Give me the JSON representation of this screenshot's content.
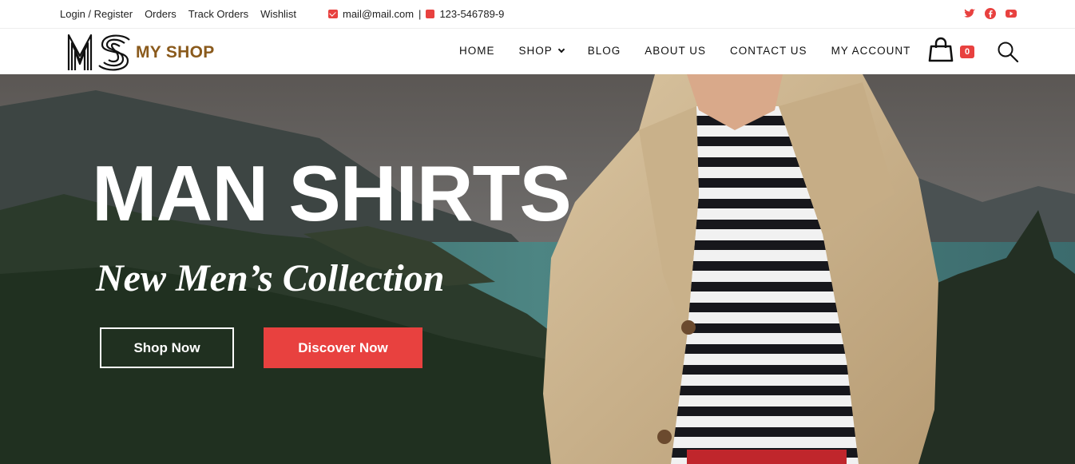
{
  "topbar": {
    "links": [
      "Login / Register",
      "Orders",
      "Track Orders",
      "Wishlist"
    ],
    "email": "mail@mail.com",
    "separator": "|",
    "phone": "123-546789-9",
    "social_icons": [
      "twitter-icon",
      "facebook-icon",
      "youtube-icon"
    ],
    "accent": "#e8413f"
  },
  "header": {
    "logo_mark": "MS",
    "logo_text": "MY SHOP",
    "nav": [
      "HOME",
      "SHOP",
      "BLOG",
      "ABOUT US",
      "CONTACT US",
      "MY ACCOUNT"
    ],
    "cart_count": "0"
  },
  "hero": {
    "title": "MAN SHIRTS",
    "subtitle": "New Men’s Collection",
    "button_primary": "Shop Now",
    "button_secondary": "Discover Now"
  }
}
